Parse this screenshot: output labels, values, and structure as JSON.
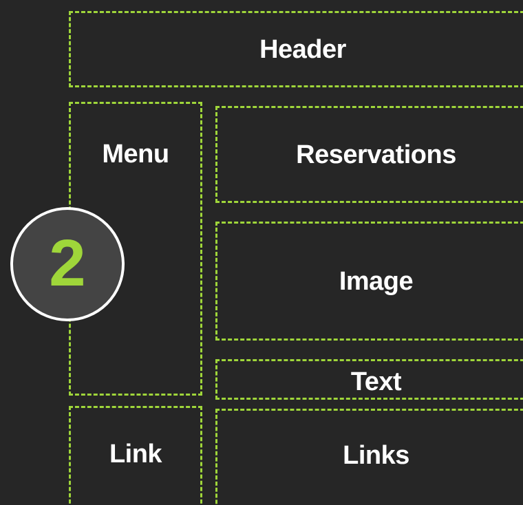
{
  "step_badge": {
    "number": "2"
  },
  "regions": {
    "header": "Header",
    "menu": "Menu",
    "reservations": "Reservations",
    "image": "Image",
    "text": "Text",
    "link": "Link",
    "links": "Links"
  },
  "colors": {
    "background": "#262626",
    "dashed_border": "#9fd63a",
    "label_text": "#ffffff",
    "badge_fill": "#444444",
    "badge_border": "#ffffff",
    "badge_number": "#9fd63a"
  }
}
